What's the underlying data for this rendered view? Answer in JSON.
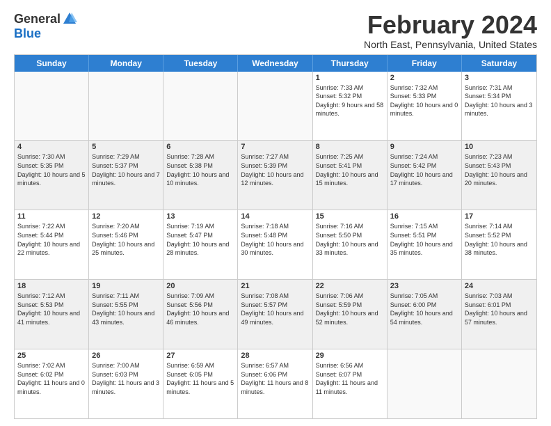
{
  "logo": {
    "general": "General",
    "blue": "Blue"
  },
  "title": "February 2024",
  "subtitle": "North East, Pennsylvania, United States",
  "days_of_week": [
    "Sunday",
    "Monday",
    "Tuesday",
    "Wednesday",
    "Thursday",
    "Friday",
    "Saturday"
  ],
  "weeks": [
    [
      {
        "day": "",
        "info": ""
      },
      {
        "day": "",
        "info": ""
      },
      {
        "day": "",
        "info": ""
      },
      {
        "day": "",
        "info": ""
      },
      {
        "day": "1",
        "info": "Sunrise: 7:33 AM\nSunset: 5:32 PM\nDaylight: 9 hours and 58 minutes."
      },
      {
        "day": "2",
        "info": "Sunrise: 7:32 AM\nSunset: 5:33 PM\nDaylight: 10 hours and 0 minutes."
      },
      {
        "day": "3",
        "info": "Sunrise: 7:31 AM\nSunset: 5:34 PM\nDaylight: 10 hours and 3 minutes."
      }
    ],
    [
      {
        "day": "4",
        "info": "Sunrise: 7:30 AM\nSunset: 5:35 PM\nDaylight: 10 hours and 5 minutes."
      },
      {
        "day": "5",
        "info": "Sunrise: 7:29 AM\nSunset: 5:37 PM\nDaylight: 10 hours and 7 minutes."
      },
      {
        "day": "6",
        "info": "Sunrise: 7:28 AM\nSunset: 5:38 PM\nDaylight: 10 hours and 10 minutes."
      },
      {
        "day": "7",
        "info": "Sunrise: 7:27 AM\nSunset: 5:39 PM\nDaylight: 10 hours and 12 minutes."
      },
      {
        "day": "8",
        "info": "Sunrise: 7:25 AM\nSunset: 5:41 PM\nDaylight: 10 hours and 15 minutes."
      },
      {
        "day": "9",
        "info": "Sunrise: 7:24 AM\nSunset: 5:42 PM\nDaylight: 10 hours and 17 minutes."
      },
      {
        "day": "10",
        "info": "Sunrise: 7:23 AM\nSunset: 5:43 PM\nDaylight: 10 hours and 20 minutes."
      }
    ],
    [
      {
        "day": "11",
        "info": "Sunrise: 7:22 AM\nSunset: 5:44 PM\nDaylight: 10 hours and 22 minutes."
      },
      {
        "day": "12",
        "info": "Sunrise: 7:20 AM\nSunset: 5:46 PM\nDaylight: 10 hours and 25 minutes."
      },
      {
        "day": "13",
        "info": "Sunrise: 7:19 AM\nSunset: 5:47 PM\nDaylight: 10 hours and 28 minutes."
      },
      {
        "day": "14",
        "info": "Sunrise: 7:18 AM\nSunset: 5:48 PM\nDaylight: 10 hours and 30 minutes."
      },
      {
        "day": "15",
        "info": "Sunrise: 7:16 AM\nSunset: 5:50 PM\nDaylight: 10 hours and 33 minutes."
      },
      {
        "day": "16",
        "info": "Sunrise: 7:15 AM\nSunset: 5:51 PM\nDaylight: 10 hours and 35 minutes."
      },
      {
        "day": "17",
        "info": "Sunrise: 7:14 AM\nSunset: 5:52 PM\nDaylight: 10 hours and 38 minutes."
      }
    ],
    [
      {
        "day": "18",
        "info": "Sunrise: 7:12 AM\nSunset: 5:53 PM\nDaylight: 10 hours and 41 minutes."
      },
      {
        "day": "19",
        "info": "Sunrise: 7:11 AM\nSunset: 5:55 PM\nDaylight: 10 hours and 43 minutes."
      },
      {
        "day": "20",
        "info": "Sunrise: 7:09 AM\nSunset: 5:56 PM\nDaylight: 10 hours and 46 minutes."
      },
      {
        "day": "21",
        "info": "Sunrise: 7:08 AM\nSunset: 5:57 PM\nDaylight: 10 hours and 49 minutes."
      },
      {
        "day": "22",
        "info": "Sunrise: 7:06 AM\nSunset: 5:59 PM\nDaylight: 10 hours and 52 minutes."
      },
      {
        "day": "23",
        "info": "Sunrise: 7:05 AM\nSunset: 6:00 PM\nDaylight: 10 hours and 54 minutes."
      },
      {
        "day": "24",
        "info": "Sunrise: 7:03 AM\nSunset: 6:01 PM\nDaylight: 10 hours and 57 minutes."
      }
    ],
    [
      {
        "day": "25",
        "info": "Sunrise: 7:02 AM\nSunset: 6:02 PM\nDaylight: 11 hours and 0 minutes."
      },
      {
        "day": "26",
        "info": "Sunrise: 7:00 AM\nSunset: 6:03 PM\nDaylight: 11 hours and 3 minutes."
      },
      {
        "day": "27",
        "info": "Sunrise: 6:59 AM\nSunset: 6:05 PM\nDaylight: 11 hours and 5 minutes."
      },
      {
        "day": "28",
        "info": "Sunrise: 6:57 AM\nSunset: 6:06 PM\nDaylight: 11 hours and 8 minutes."
      },
      {
        "day": "29",
        "info": "Sunrise: 6:56 AM\nSunset: 6:07 PM\nDaylight: 11 hours and 11 minutes."
      },
      {
        "day": "",
        "info": ""
      },
      {
        "day": "",
        "info": ""
      }
    ]
  ]
}
